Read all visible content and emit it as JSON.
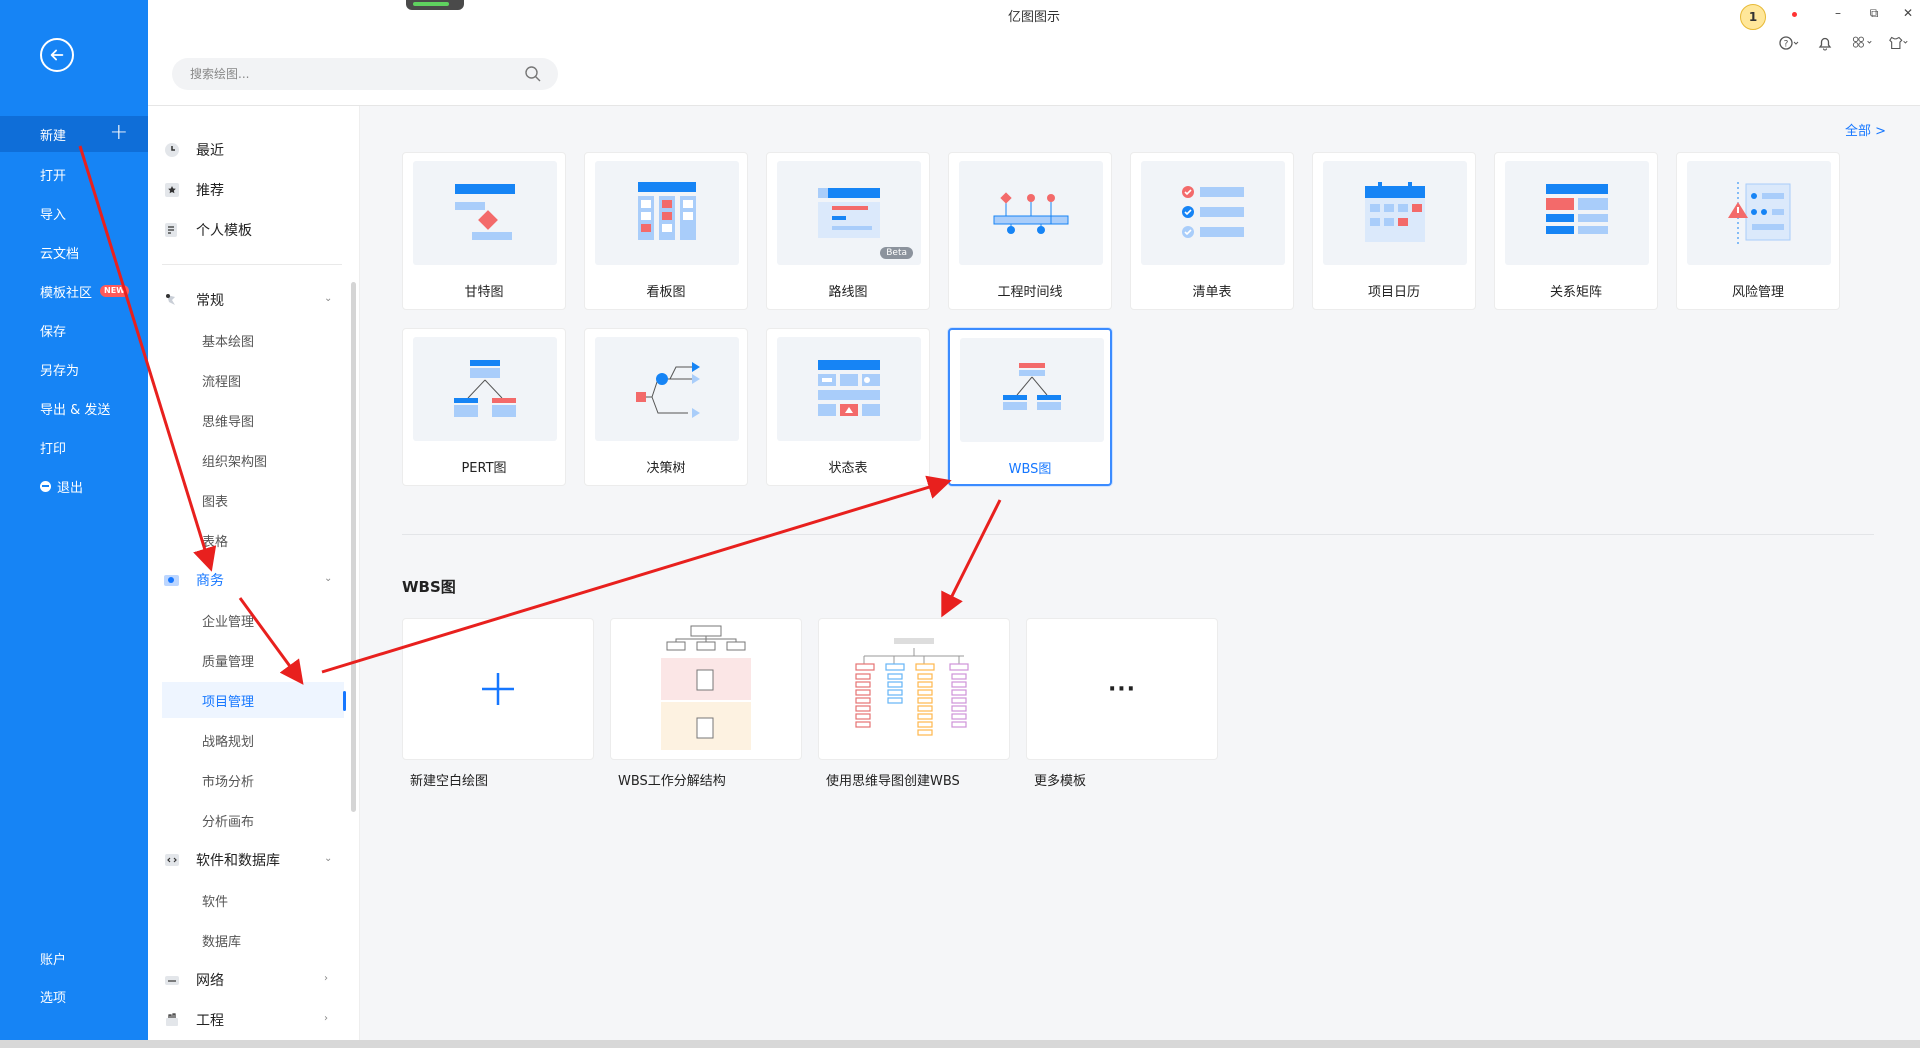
{
  "window": {
    "title": "亿图图示",
    "user_badge": "1",
    "controls": [
      "–",
      "⧉",
      "✕"
    ]
  },
  "search": {
    "placeholder": "搜索绘图..."
  },
  "rail": {
    "items": [
      {
        "label": "新建",
        "active": true,
        "plus": "+"
      },
      {
        "label": "打开"
      },
      {
        "label": "导入"
      },
      {
        "label": "云文档"
      },
      {
        "label": "模板社区",
        "badge": "NEW"
      },
      {
        "label": "保存"
      },
      {
        "label": "另存为"
      },
      {
        "label": "导出 & 发送"
      },
      {
        "label": "打印"
      },
      {
        "label": "退出"
      }
    ],
    "bottom": [
      {
        "label": "账户"
      },
      {
        "label": "选项"
      }
    ]
  },
  "categories": {
    "top": [
      {
        "label": "最近",
        "icon": "clock-icon"
      },
      {
        "label": "推荐",
        "icon": "star-icon"
      },
      {
        "label": "个人模板",
        "icon": "template-icon"
      }
    ],
    "groups": [
      {
        "label": "常规",
        "icon": "general-icon",
        "chevron": "⌄",
        "subs": [
          "基本绘图",
          "流程图",
          "思维导图",
          "组织架构图",
          "图表",
          "表格"
        ]
      },
      {
        "label": "商务",
        "icon": "business-icon",
        "chevron": "⌄",
        "active": true,
        "subs": [
          "企业管理",
          "质量管理",
          "项目管理",
          "战略规划",
          "市场分析",
          "分析画布"
        ]
      },
      {
        "label": "软件和数据库",
        "icon": "code-icon",
        "chevron": "⌄",
        "subs": [
          "软件",
          "数据库"
        ]
      },
      {
        "label": "网络",
        "icon": "network-icon",
        "chevron": "›"
      },
      {
        "label": "工程",
        "icon": "engineering-icon",
        "chevron": "›"
      }
    ],
    "active_sub": "项目管理"
  },
  "content": {
    "view_all": "全部  >",
    "templates": [
      {
        "label": "甘特图",
        "icon": "gantt-icon"
      },
      {
        "label": "看板图",
        "icon": "kanban-icon"
      },
      {
        "label": "路线图",
        "icon": "roadmap-icon",
        "badge": "Beta"
      },
      {
        "label": "工程时间线",
        "icon": "timeline-icon"
      },
      {
        "label": "清单表",
        "icon": "checklist-icon"
      },
      {
        "label": "项目日历",
        "icon": "calendar-icon"
      },
      {
        "label": "关系矩阵",
        "icon": "matrix-icon"
      },
      {
        "label": "风险管理",
        "icon": "risk-icon"
      },
      {
        "label": "PERT图",
        "icon": "pert-icon"
      },
      {
        "label": "决策树",
        "icon": "decision-tree-icon"
      },
      {
        "label": "状态表",
        "icon": "status-table-icon"
      },
      {
        "label": "WBS图",
        "icon": "wbs-icon",
        "selected": true
      }
    ],
    "section_title": "WBS图",
    "samples": [
      {
        "label": "新建空白绘图",
        "icon": "plus-icon"
      },
      {
        "label": "WBS工作分解结构",
        "icon": "wbs-sample-thumb"
      },
      {
        "label": "使用思维导图创建WBS",
        "icon": "mindmap-wbs-thumb"
      },
      {
        "label": "更多模板",
        "icon": "more-icon",
        "glyph": "···"
      }
    ]
  },
  "colors": {
    "rail": "#1684f5",
    "accent": "#1677ff",
    "arrow": "#e8201e"
  }
}
